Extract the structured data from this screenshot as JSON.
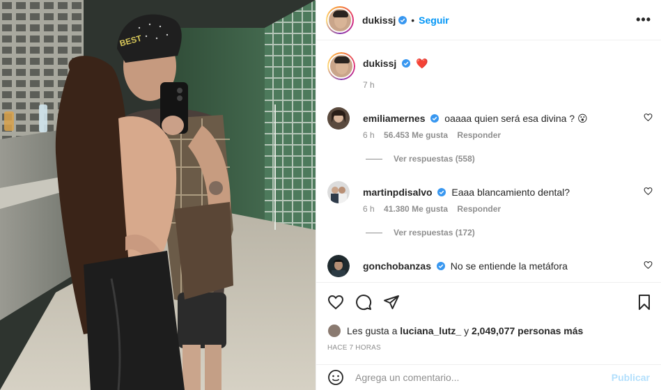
{
  "post": {
    "author": "dukissj",
    "follow_label": "Seguir",
    "dot": "•",
    "more_label": "•••",
    "caption_emoji": "❤️",
    "caption_time": "7 h"
  },
  "comments": [
    {
      "user": "emiliamernes",
      "text": "oaaaa quien será esa divina ? 😮",
      "time": "6 h",
      "likes": "56.453 Me gusta",
      "reply": "Responder",
      "view_replies": "Ver respuestas (558)"
    },
    {
      "user": "martinpdisalvo",
      "text": "Eaaa blancamiento dental?",
      "time": "6 h",
      "likes": "41.380 Me gusta",
      "reply": "Responder",
      "view_replies": "Ver respuestas (172)"
    },
    {
      "user": "gonchobanzas",
      "text": "No se entiende la metáfora"
    }
  ],
  "likes_line": {
    "prefix": "Les gusta a",
    "user": "luciana_lutz_",
    "middle": "y",
    "count": "2,049,077 personas más"
  },
  "timestamp": "HACE 7 HORAS",
  "composer": {
    "placeholder": "Agrega un comentario...",
    "publish_label": "Publicar"
  },
  "colors": {
    "accent": "#0095f6",
    "publish_disabled": "#b2dffc",
    "verified": "#3897f0",
    "heart": "#ed4956"
  }
}
